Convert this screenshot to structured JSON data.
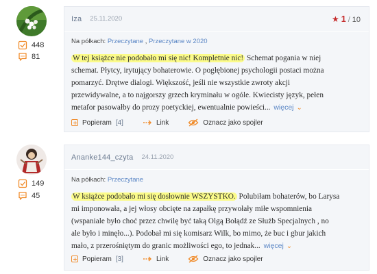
{
  "reviews": [
    {
      "username": "Iza",
      "date": "25.11.2020",
      "rating": {
        "value": "1",
        "max": "10"
      },
      "stats": {
        "shelf_count": "448",
        "comment_count": "81"
      },
      "shelves_label": "Na półkach:",
      "shelves": [
        "Przeczytane",
        "Przeczytane w 2020"
      ],
      "highlight": "W tej książce nie podobało mi się nic! Kompletnie nic!",
      "review_lines": [
        " Schemat pogania w niej",
        "schemat. Płytcy, irytujący bohaterowie. O pogłębionej psychologii postaci można",
        "pomarzyć. Drętwe dialogi. Większość, jeśli nie wszystkie zwroty akcji",
        "przewidywalne, a to najgorszy grzech kryminału w ogóle. Kwiecisty język, pełen",
        "metafor pasowałby do prozy poetyckiej, ewentualnie powieści..."
      ],
      "more_label": "więcej",
      "actions": {
        "like_label": "Popieram",
        "like_count": "[4]",
        "link_label": "Link",
        "spoiler_label": "Oznacz jako spojler"
      },
      "icons": {
        "avatar": "lily-of-the-valley-avatar",
        "shelf": "book-icon",
        "comment": "comment-icon",
        "star": "star-icon"
      }
    },
    {
      "username": "Ananke144_czyta",
      "date": "24.11.2020",
      "stats": {
        "shelf_count": "149",
        "comment_count": "45"
      },
      "shelves_label": "Na półkach:",
      "shelves": [
        "Przeczytane"
      ],
      "highlight": "W książce podobało mi się dosłownie WSZYSTKO.",
      "review_lines": [
        " Polubiłam bohaterów, bo Larysa",
        "mi imponowała, a jej włosy obcięte na zapałkę przywołały miłe wspomnienia",
        "(wspaniale było choć przez chwilę być taką Olgą Bołądź ze Służb Specjalnych , no",
        "ale było i minęło...). Podobał mi się komisarz Wilk, bo mimo, że buc i gbur jakich",
        "mało, z przerośniętym do granic możliwości ego, to jednak..."
      ],
      "more_label": "więcej",
      "actions": {
        "like_label": "Popieram",
        "like_count": "[3]",
        "link_label": "Link",
        "spoiler_label": "Oznacz jako spojler"
      },
      "icons": {
        "avatar": "doll-avatar",
        "shelf": "book-icon",
        "comment": "comment-icon"
      }
    }
  ],
  "colors": {
    "accent_orange": "#f08b2a",
    "link_blue": "#5a86c5",
    "rating_red": "#c52a2a",
    "highlight_yellow": "#fbfb8a",
    "card_bg": "#f4f6f9"
  }
}
